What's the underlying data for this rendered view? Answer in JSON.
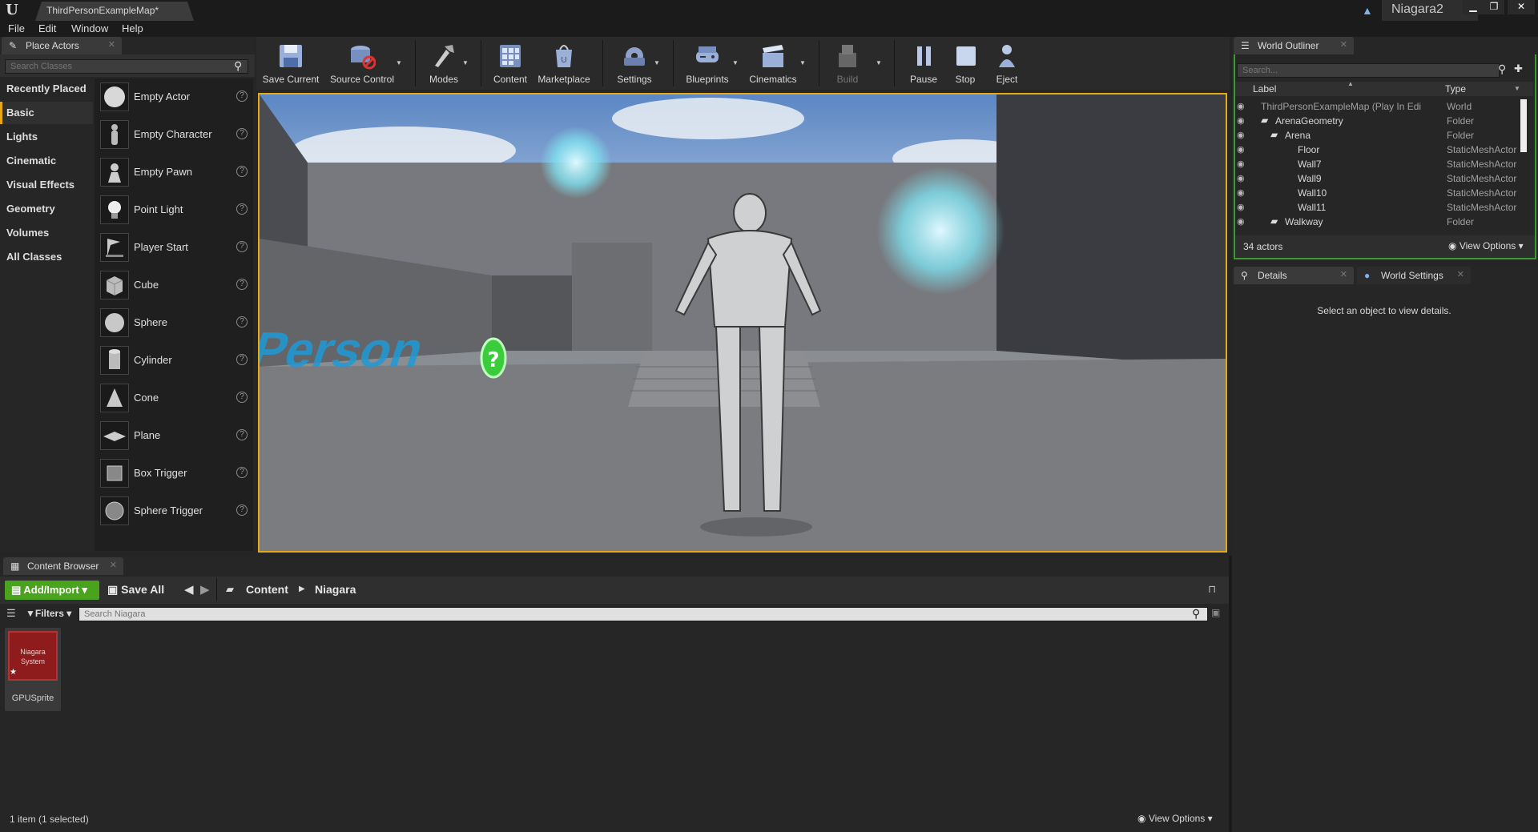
{
  "window": {
    "doc_tab": "ThirdPersonExampleMap*",
    "project_name": "Niagara2"
  },
  "menu": [
    "File",
    "Edit",
    "Window",
    "Help"
  ],
  "place_actors": {
    "tab_label": "Place Actors",
    "search_placeholder": "Search Classes",
    "categories": [
      "Recently Placed",
      "Basic",
      "Lights",
      "Cinematic",
      "Visual Effects",
      "Geometry",
      "Volumes",
      "All Classes"
    ],
    "selected_category": "Basic",
    "actors": [
      "Empty Actor",
      "Empty Character",
      "Empty Pawn",
      "Point Light",
      "Player Start",
      "Cube",
      "Sphere",
      "Cylinder",
      "Cone",
      "Plane",
      "Box Trigger",
      "Sphere Trigger"
    ]
  },
  "toolbar": {
    "save_current": "Save Current",
    "source_control": "Source Control",
    "modes": "Modes",
    "content": "Content",
    "marketplace": "Marketplace",
    "settings": "Settings",
    "blueprints": "Blueprints",
    "cinematics": "Cinematics",
    "build": "Build",
    "pause": "Pause",
    "stop": "Stop",
    "eject": "Eject"
  },
  "viewport": {
    "floor_text": "ird Person"
  },
  "world_outliner": {
    "tab_label": "World Outliner",
    "search_placeholder": "Search...",
    "col_label": "Label",
    "col_type": "Type",
    "rows": [
      {
        "label": "ThirdPersonExampleMap (Play In Edi",
        "type": "World"
      },
      {
        "label": "ArenaGeometry",
        "type": "Folder"
      },
      {
        "label": "Arena",
        "type": "Folder"
      },
      {
        "label": "Floor",
        "type": "StaticMeshActor"
      },
      {
        "label": "Wall7",
        "type": "StaticMeshActor"
      },
      {
        "label": "Wall9",
        "type": "StaticMeshActor"
      },
      {
        "label": "Wall10",
        "type": "StaticMeshActor"
      },
      {
        "label": "Wall11",
        "type": "StaticMeshActor"
      },
      {
        "label": "Walkway",
        "type": "Folder"
      }
    ],
    "actor_count": "34 actors",
    "view_options": "View Options"
  },
  "details": {
    "tab_label": "Details",
    "world_settings_label": "World Settings",
    "empty_message": "Select an object to view details."
  },
  "content_browser": {
    "tab_label": "Content Browser",
    "add_import": "Add/Import",
    "save_all": "Save All",
    "path": [
      "Content",
      "Niagara"
    ],
    "filters": "Filters",
    "search_placeholder": "Search Niagara",
    "asset": {
      "type_label": "Niagara System",
      "name": "GPUSprite"
    },
    "status": "1 item (1 selected)",
    "view_options": "View Options"
  }
}
